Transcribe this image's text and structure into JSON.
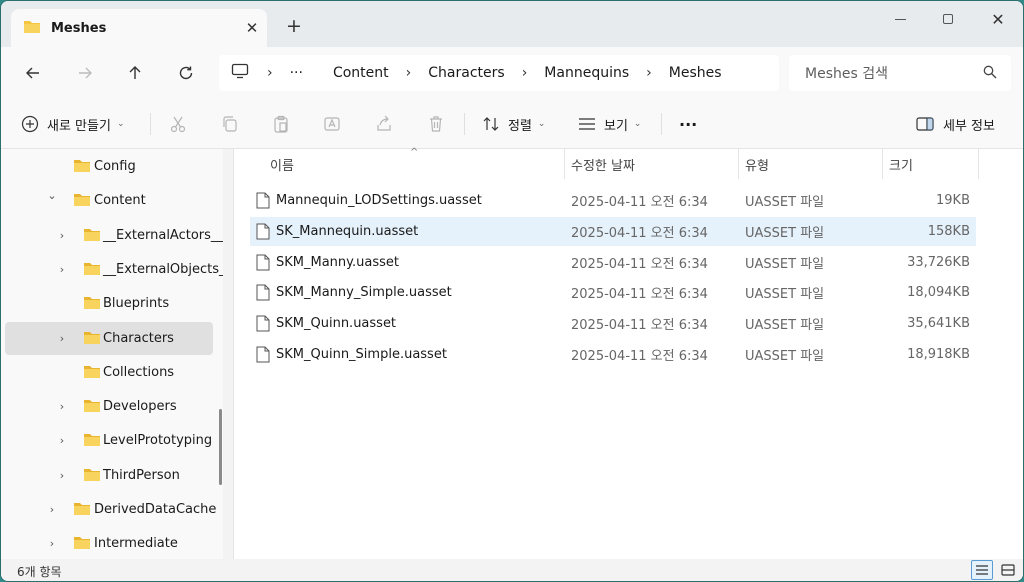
{
  "window": {
    "tab_title": "Meshes",
    "new_tab_label": "+"
  },
  "address": {
    "overflow": "···",
    "breadcrumbs": [
      "Content",
      "Characters",
      "Mannequins",
      "Meshes"
    ]
  },
  "search": {
    "placeholder": "Meshes 검색"
  },
  "commands": {
    "new": "새로 만들기",
    "sort": "정렬",
    "view": "보기",
    "more": "···",
    "details": "세부 정보"
  },
  "sidebar": {
    "items": [
      {
        "label": "Config",
        "indent": 0,
        "expand": "none"
      },
      {
        "label": "Content",
        "indent": 0,
        "expand": "expanded"
      },
      {
        "label": "__ExternalActors__",
        "indent": 1,
        "expand": "collapsed"
      },
      {
        "label": "__ExternalObjects__",
        "indent": 1,
        "expand": "collapsed"
      },
      {
        "label": "Blueprints",
        "indent": 1,
        "expand": "none"
      },
      {
        "label": "Characters",
        "indent": 1,
        "expand": "collapsed",
        "selected": true
      },
      {
        "label": "Collections",
        "indent": 1,
        "expand": "none"
      },
      {
        "label": "Developers",
        "indent": 1,
        "expand": "collapsed"
      },
      {
        "label": "LevelPrototyping",
        "indent": 1,
        "expand": "collapsed"
      },
      {
        "label": "ThirdPerson",
        "indent": 1,
        "expand": "collapsed"
      },
      {
        "label": "DerivedDataCache",
        "indent": 0,
        "expand": "collapsed"
      },
      {
        "label": "Intermediate",
        "indent": 0,
        "expand": "collapsed"
      }
    ]
  },
  "columns": {
    "name": "이름",
    "date": "수정한 날짜",
    "type": "유형",
    "size": "크기"
  },
  "files": [
    {
      "name": "Mannequin_LODSettings.uasset",
      "date": "2025-04-11 오전 6:34",
      "type": "UASSET 파일",
      "size": "19KB"
    },
    {
      "name": "SK_Mannequin.uasset",
      "date": "2025-04-11 오전 6:34",
      "type": "UASSET 파일",
      "size": "158KB",
      "selected": true
    },
    {
      "name": "SKM_Manny.uasset",
      "date": "2025-04-11 오전 6:34",
      "type": "UASSET 파일",
      "size": "33,726KB"
    },
    {
      "name": "SKM_Manny_Simple.uasset",
      "date": "2025-04-11 오전 6:34",
      "type": "UASSET 파일",
      "size": "18,094KB"
    },
    {
      "name": "SKM_Quinn.uasset",
      "date": "2025-04-11 오전 6:34",
      "type": "UASSET 파일",
      "size": "35,641KB"
    },
    {
      "name": "SKM_Quinn_Simple.uasset",
      "date": "2025-04-11 오전 6:34",
      "type": "UASSET 파일",
      "size": "18,918KB"
    }
  ],
  "status": {
    "count": "6개 항목"
  },
  "colors": {
    "folder": "#f5c542",
    "selection": "#e5f1fb",
    "accent": "#0067c0"
  }
}
